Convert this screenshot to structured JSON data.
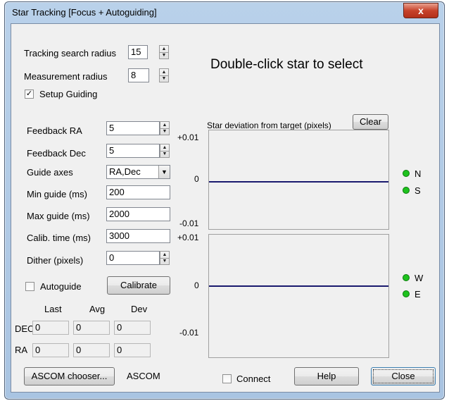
{
  "window": {
    "title": "Star Tracking [Focus + Autoguiding]",
    "close_glyph": "x"
  },
  "tracking": {
    "search_radius_label": "Tracking search radius",
    "search_radius_value": "15",
    "measurement_radius_label": "Measurement radius",
    "measurement_radius_value": "8",
    "setup_guiding_label": "Setup Guiding",
    "setup_guiding_checked": true
  },
  "instruction": "Double-click star to select",
  "guiding": {
    "feedback_ra_label": "Feedback RA",
    "feedback_ra_value": "5",
    "feedback_dec_label": "Feedback Dec",
    "feedback_dec_value": "5",
    "guide_axes_label": "Guide axes",
    "guide_axes_value": "RA,Dec",
    "min_guide_label": "Min guide (ms)",
    "min_guide_value": "200",
    "max_guide_label": "Max guide (ms)",
    "max_guide_value": "2000",
    "calib_time_label": "Calib. time (ms)",
    "calib_time_value": "3000",
    "dither_label": "Dither (pixels)",
    "dither_value": "0",
    "autoguide_label": "Autoguide",
    "calibrate_label": "Calibrate"
  },
  "stats": {
    "headers": [
      "Last",
      "Avg",
      "Dev"
    ],
    "dec_label": "DEC",
    "ra_label": "RA",
    "dec_values": [
      "0",
      "0",
      "0"
    ],
    "ra_values": [
      "0",
      "0",
      "0"
    ]
  },
  "plot": {
    "title": "Star deviation from target (pixels)",
    "clear_label": "Clear",
    "top": {
      "ymax": "+0.01",
      "zero": "0",
      "ymin": "-0.01",
      "legend": [
        "N",
        "S"
      ]
    },
    "bottom": {
      "ymax": "+0.01",
      "zero": "0",
      "ymin": "-0.01",
      "legend": [
        "W",
        "E"
      ]
    },
    "line_color": "#1a1a6e",
    "indicator_color": "#1ec21e"
  },
  "footer": {
    "ascom_chooser_label": "ASCOM chooser...",
    "ascom_label": "ASCOM",
    "connect_label": "Connect",
    "help_label": "Help",
    "close_label": "Close"
  },
  "icons": {
    "check": "✓",
    "spin_up": "▲",
    "spin_down": "▼",
    "dropdown": "▼"
  }
}
